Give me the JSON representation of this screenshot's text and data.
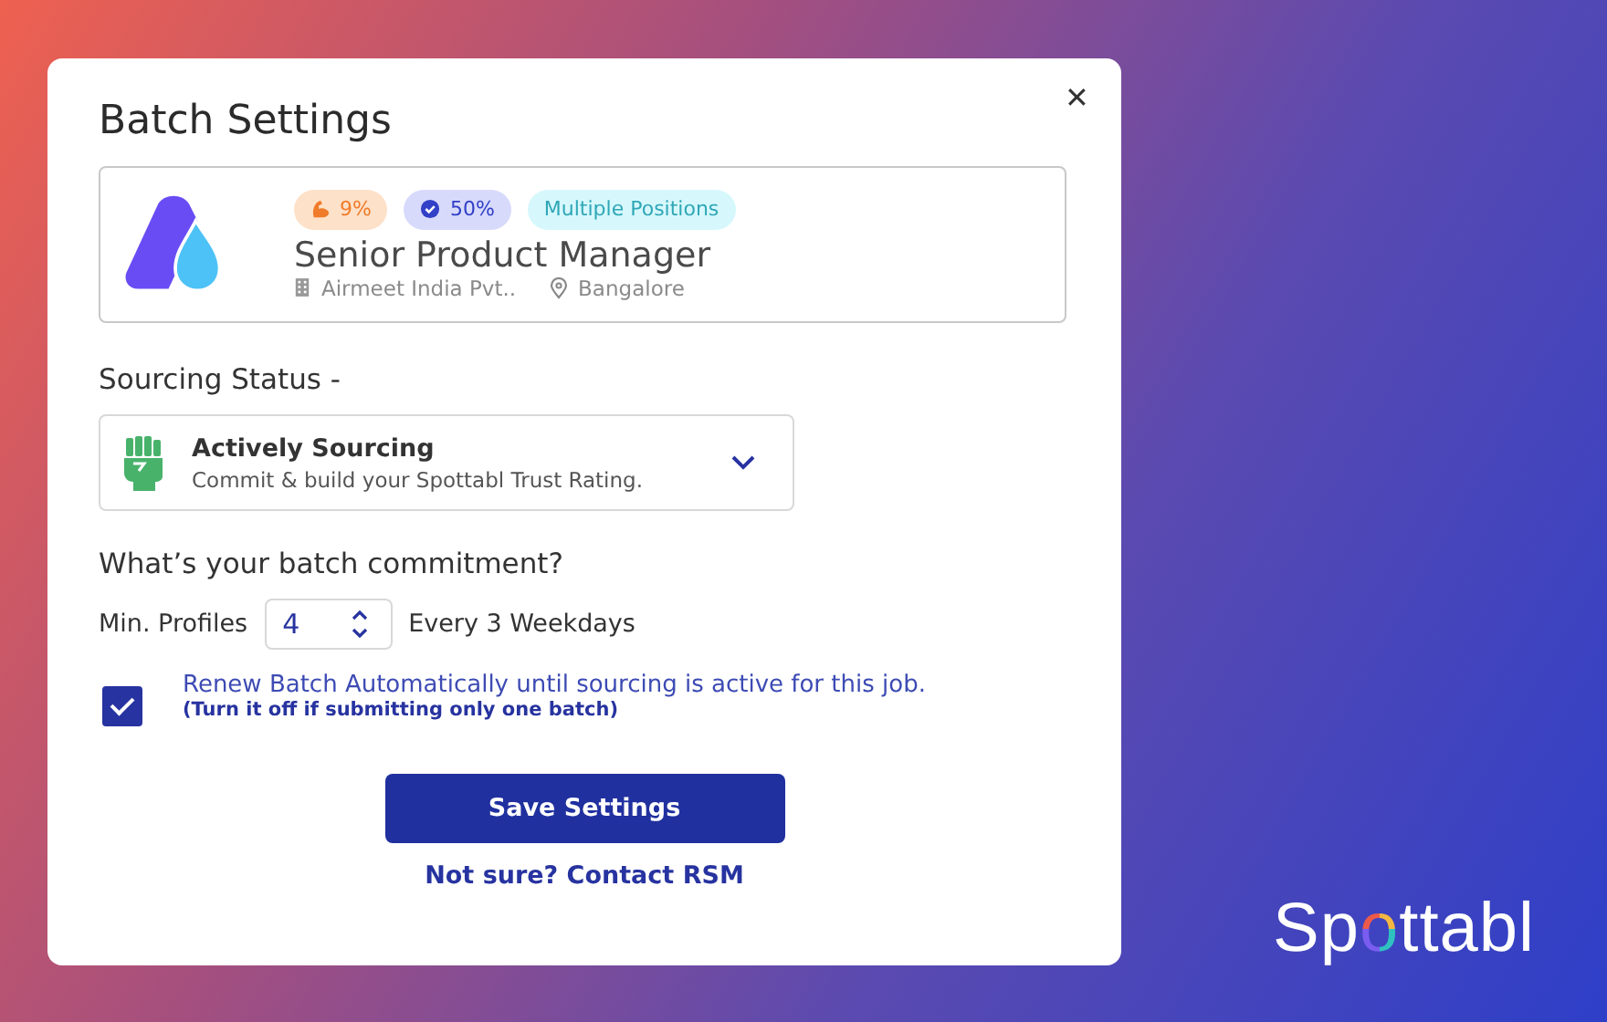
{
  "dialog": {
    "title": "Batch Settings",
    "close": "✕"
  },
  "job": {
    "badges": [
      {
        "kind": "score",
        "text": "9%"
      },
      {
        "kind": "verified",
        "text": "50%"
      },
      {
        "kind": "tag",
        "text": "Multiple Positions"
      }
    ],
    "title": "Senior Product Manager",
    "company": "Airmeet India Pvt..",
    "location": "Bangalore"
  },
  "sourcing": {
    "heading": "Sourcing Status -",
    "status": "Actively Sourcing",
    "description": "Commit & build your Spottabl Trust Rating."
  },
  "commitment": {
    "heading": "What’s your batch commitment?",
    "label": "Min. Profiles",
    "value": "4",
    "suffix": "Every 3 Weekdays"
  },
  "renew": {
    "checked": true,
    "label": "Renew Batch Automatically until sourcing is active for this job.",
    "hint": "(Turn it off if submitting only one batch)"
  },
  "save_button": "Save Settings",
  "contact_link": "Not sure? Contact RSM",
  "brand": {
    "logo": "Spottabl"
  }
}
